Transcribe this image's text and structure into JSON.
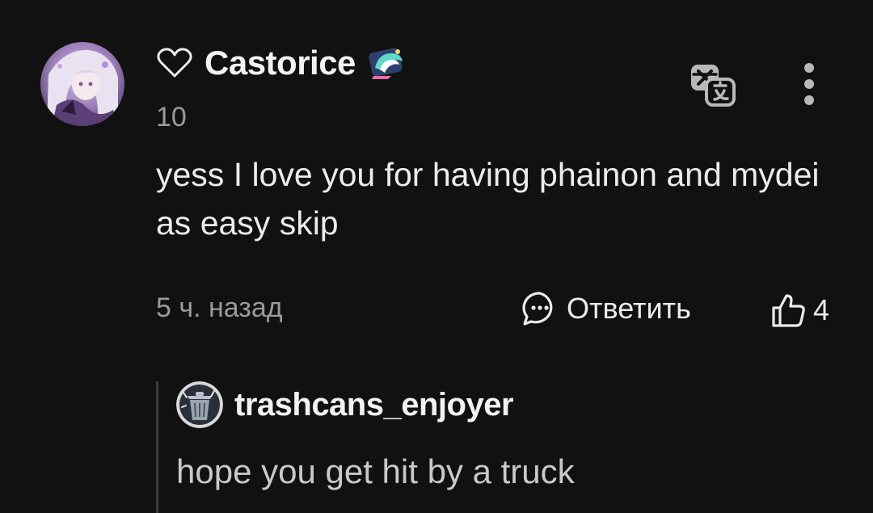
{
  "comment": {
    "author": {
      "username": "Castorice",
      "level": "10",
      "avatar_icon": "anime-character-avatar",
      "badge_icon": "winged-badge-icon"
    },
    "text": "yess I love you for having phainon and mydei as easy skip",
    "timestamp": "5 ч. назад",
    "actions": {
      "reply_label": "Ответить",
      "like_count": "4"
    }
  },
  "reply": {
    "author": {
      "username": "trashcans_enjoyer",
      "avatar_icon": "trashcan-avatar"
    },
    "text": "hope you get hit by a truck"
  },
  "colors": {
    "background": "#111112",
    "text_primary": "#ececec",
    "text_secondary": "#9b9b9b",
    "quote_bar": "#3a3a3d"
  }
}
